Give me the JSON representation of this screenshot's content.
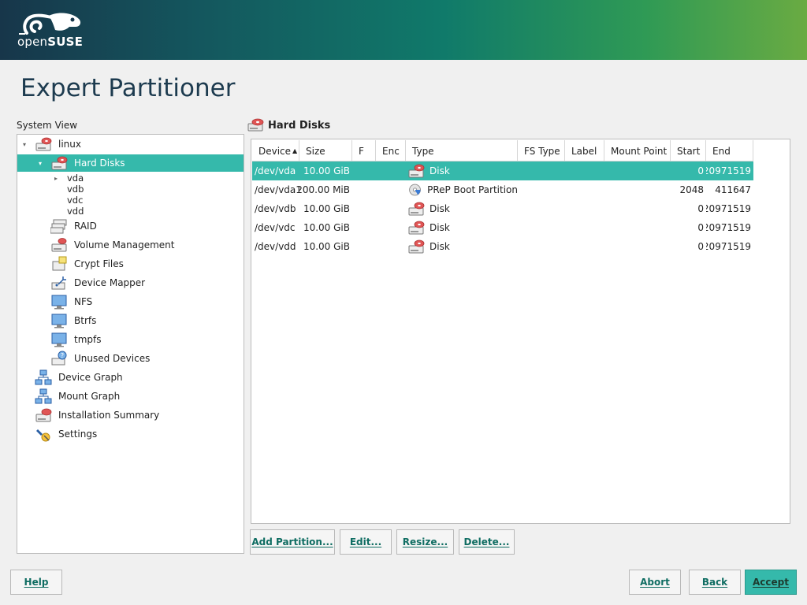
{
  "banner": {
    "logo_text_light": "open",
    "logo_text_bold": "SUSE"
  },
  "page": {
    "title": "Expert Partitioner"
  },
  "tree": {
    "label": "System View",
    "items": [
      {
        "label": "linux",
        "icon": "computer-disk-icon",
        "indent": 0,
        "expanded": true
      },
      {
        "label": "Hard Disks",
        "icon": "hard-disk-icon",
        "indent": 1,
        "expanded": true,
        "selected": true
      },
      {
        "label": "vda",
        "indent": 2,
        "collapsed": true
      },
      {
        "label": "vdb",
        "indent": 2
      },
      {
        "label": "vdc",
        "indent": 2
      },
      {
        "label": "vdd",
        "indent": 2
      },
      {
        "label": "RAID",
        "icon": "raid-icon",
        "indent": 1
      },
      {
        "label": "Volume Management",
        "icon": "volume-management-icon",
        "indent": 1
      },
      {
        "label": "Crypt Files",
        "icon": "crypt-files-icon",
        "indent": 1
      },
      {
        "label": "Device Mapper",
        "icon": "device-mapper-icon",
        "indent": 1
      },
      {
        "label": "NFS",
        "icon": "nfs-icon",
        "indent": 1
      },
      {
        "label": "Btrfs",
        "icon": "btrfs-icon",
        "indent": 1
      },
      {
        "label": "tmpfs",
        "icon": "tmpfs-icon",
        "indent": 1
      },
      {
        "label": "Unused Devices",
        "icon": "unused-devices-icon",
        "indent": 1
      },
      {
        "label": "Device Graph",
        "icon": "device-graph-icon",
        "indent": 0
      },
      {
        "label": "Mount Graph",
        "icon": "mount-graph-icon",
        "indent": 0
      },
      {
        "label": "Installation Summary",
        "icon": "installation-summary-icon",
        "indent": 0
      },
      {
        "label": "Settings",
        "icon": "settings-icon",
        "indent": 0
      }
    ]
  },
  "panel": {
    "title": "Hard Disks"
  },
  "table": {
    "columns": [
      "Device",
      "Size",
      "F",
      "Enc",
      "Type",
      "FS Type",
      "Label",
      "Mount Point",
      "Start",
      "End"
    ],
    "sort_column": "Device",
    "rows": [
      {
        "device": "/dev/vda",
        "size": "10.00 GiB",
        "f": "",
        "enc": "",
        "type": "Disk",
        "type_icon": "disk-icon",
        "fs_type": "",
        "label": "",
        "mount_point": "",
        "start": "0",
        "end": "20971519",
        "selected": true
      },
      {
        "device": "/dev/vda1",
        "size": "200.00 MiB",
        "f": "",
        "enc": "",
        "type": "PReP Boot Partition",
        "type_icon": "partition-icon",
        "fs_type": "",
        "label": "",
        "mount_point": "",
        "start": "2048",
        "end": "411647"
      },
      {
        "device": "/dev/vdb",
        "size": "10.00 GiB",
        "f": "",
        "enc": "",
        "type": "Disk",
        "type_icon": "disk-icon",
        "fs_type": "",
        "label": "",
        "mount_point": "",
        "start": "0",
        "end": "20971519"
      },
      {
        "device": "/dev/vdc",
        "size": "10.00 GiB",
        "f": "",
        "enc": "",
        "type": "Disk",
        "type_icon": "disk-icon",
        "fs_type": "",
        "label": "",
        "mount_point": "",
        "start": "0",
        "end": "20971519"
      },
      {
        "device": "/dev/vdd",
        "size": "10.00 GiB",
        "f": "",
        "enc": "",
        "type": "Disk",
        "type_icon": "disk-icon",
        "fs_type": "",
        "label": "",
        "mount_point": "",
        "start": "0",
        "end": "20971519"
      }
    ]
  },
  "actions": {
    "add_partition": "Add Partition...",
    "edit": "Edit...",
    "resize": "Resize...",
    "delete": "Delete..."
  },
  "footer": {
    "help": "Help",
    "abort": "Abort",
    "back": "Back",
    "accept": "Accept"
  },
  "colors": {
    "accent": "#35b9ab",
    "title": "#1d3b4f",
    "button_text": "#0f6d62"
  }
}
